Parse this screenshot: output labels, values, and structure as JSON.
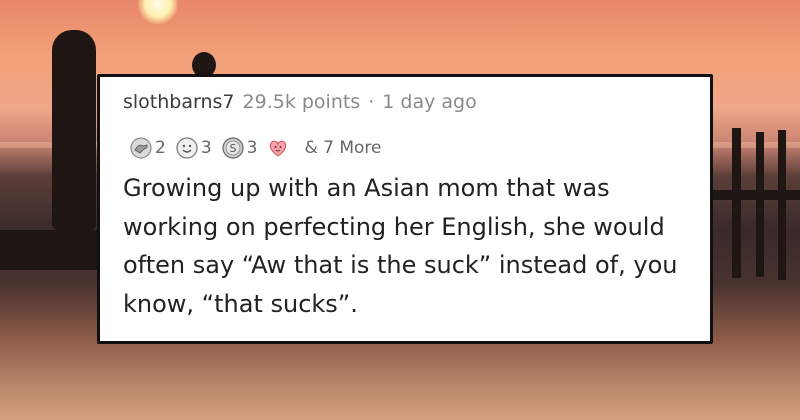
{
  "comment": {
    "username": "slothbarns7",
    "points": "29.5k points",
    "separator": "·",
    "time": "1 day ago",
    "awards": [
      {
        "icon": "helping-hand-award-icon",
        "count": "2"
      },
      {
        "icon": "wholesome-award-icon",
        "count": "3"
      },
      {
        "icon": "silver-award-icon",
        "count": "3"
      },
      {
        "icon": "heart-award-icon",
        "count": ""
      }
    ],
    "more_awards": "& 7 More",
    "body": "Growing up with an Asian mom that was working on perfecting her English, she would often say “Aw that is the suck” instead of, you know, “that sucks”."
  },
  "colors": {
    "card_background": "#ffffff",
    "card_border": "#111111",
    "username": "#3b3b3b",
    "meta": "#8a8a8a",
    "body_text": "#222222",
    "sky": "#f0a788",
    "sea": "#3a2a2a"
  }
}
